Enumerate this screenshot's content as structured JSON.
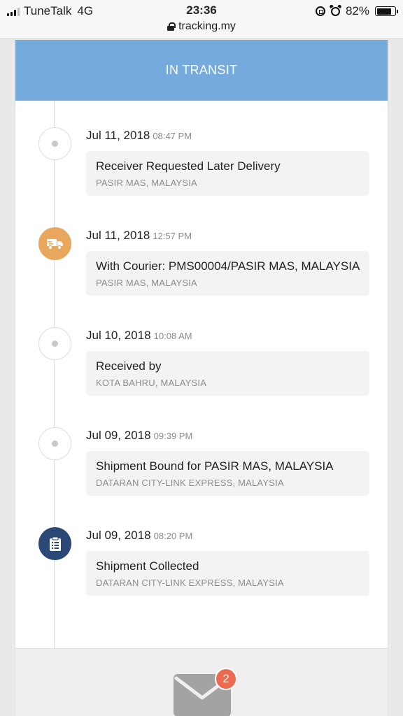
{
  "status_bar": {
    "carrier": "TuneTalk",
    "network": "4G",
    "time": "23:36",
    "url": "tracking.my",
    "battery_percent": "82%",
    "battery_level": 0.82
  },
  "banner": {
    "status": "IN TRANSIT",
    "color": "#74aadc"
  },
  "events": [
    {
      "date": "Jul 11, 2018",
      "time": "08:47 PM",
      "title": "Receiver Requested Later Delivery",
      "location": "PASIR MAS, MALAYSIA",
      "icon": "dot-icon"
    },
    {
      "date": "Jul 11, 2018",
      "time": "12:57 PM",
      "title": "With Courier: PMS00004/PASIR MAS, MALAYSIA",
      "location": "PASIR MAS, MALAYSIA",
      "icon": "delivery-truck-icon",
      "color": "#e9a65d"
    },
    {
      "date": "Jul 10, 2018",
      "time": "10:08 AM",
      "title": "Received by",
      "location": "KOTA BAHRU, MALAYSIA",
      "icon": "dot-icon"
    },
    {
      "date": "Jul 09, 2018",
      "time": "09:39 PM",
      "title": "Shipment Bound for PASIR MAS, MALAYSIA",
      "location": "DATARAN CITY-LINK EXPRESS, MALAYSIA",
      "icon": "dot-icon"
    },
    {
      "date": "Jul 09, 2018",
      "time": "08:20 PM",
      "title": "Shipment Collected",
      "location": "DATARAN CITY-LINK EXPRESS, MALAYSIA",
      "icon": "clipboard-icon",
      "color": "#2c4877"
    }
  ],
  "footer": {
    "mail_badge_count": "2",
    "badge_color": "#ec6a4f"
  }
}
